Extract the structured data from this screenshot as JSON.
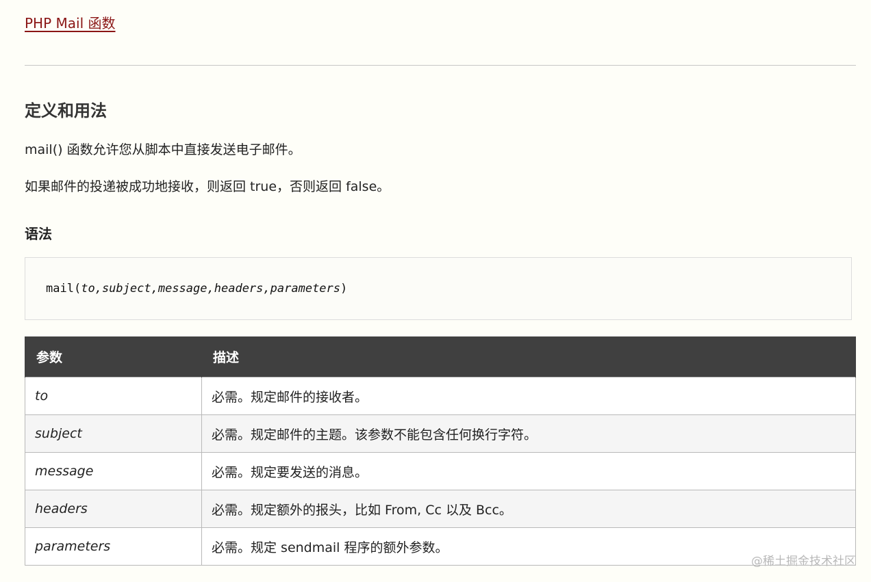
{
  "top_link": "PHP Mail 函数",
  "definition": {
    "heading": "定义和用法",
    "para1": "mail() 函数允许您从脚本中直接发送电子邮件。",
    "para2": "如果邮件的投递被成功地接收，则返回 true，否则返回 false。"
  },
  "syntax": {
    "heading": "语法",
    "fn": "mail",
    "open": "(",
    "args": [
      "to",
      "subject",
      "message",
      "headers",
      "parameters"
    ],
    "sep": ",",
    "close": ")"
  },
  "table": {
    "headers": [
      "参数",
      "描述"
    ],
    "rows": [
      {
        "param": "to",
        "desc": "必需。规定邮件的接收者。"
      },
      {
        "param": "subject",
        "desc": "必需。规定邮件的主题。该参数不能包含任何换行字符。"
      },
      {
        "param": "message",
        "desc": "必需。规定要发送的消息。"
      },
      {
        "param": "headers",
        "desc": "必需。规定额外的报头，比如 From, Cc 以及 Bcc。"
      },
      {
        "param": "parameters",
        "desc": "必需。规定 sendmail 程序的额外参数。"
      }
    ]
  },
  "watermark": "@稀土掘金技术社区",
  "colors": {
    "background": "#fefef8",
    "link": "#8a1515",
    "table_header": "#404040"
  }
}
